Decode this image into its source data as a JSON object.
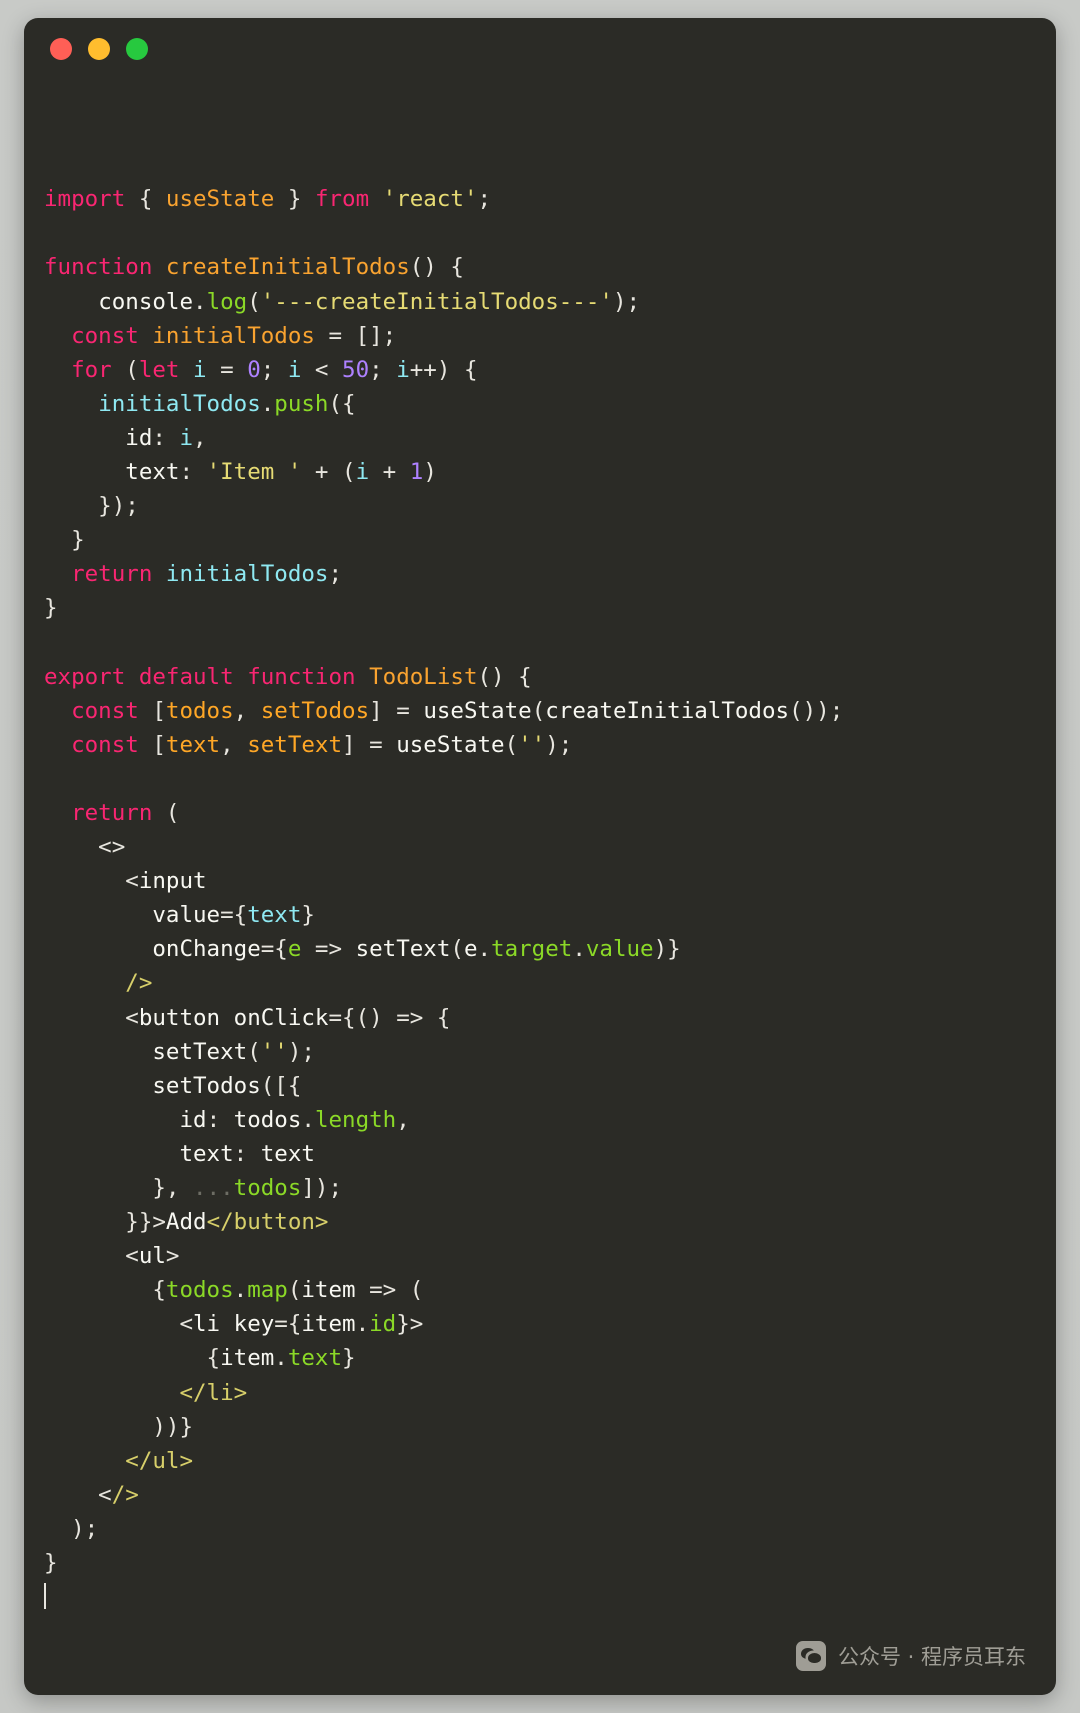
{
  "window": {
    "traffic_lights": [
      {
        "name": "close",
        "color": "#ff5f56"
      },
      {
        "name": "minimize",
        "color": "#ffbd2e"
      },
      {
        "name": "maximize",
        "color": "#27c93f"
      }
    ]
  },
  "theme": {
    "background": "#2b2b26",
    "page_background": "#c8cac7",
    "plain": "#f8f8f2",
    "keyword": "#f92672",
    "function": "#f9a330",
    "string": "#e6db74",
    "number": "#ae81ff",
    "identifier": "#8fe9f2",
    "property": "#8bd927",
    "closing_tag": "#d7cf6a",
    "dim": "#6d6d64"
  },
  "code": {
    "language": "jsx",
    "lines": [
      "import { useState } from 'react';",
      "",
      "function createInitialTodos() {",
      "    console.log('---createInitialTodos---');",
      "  const initialTodos = [];",
      "  for (let i = 0; i < 50; i++) {",
      "    initialTodos.push({",
      "      id: i,",
      "      text: 'Item ' + (i + 1)",
      "    });",
      "  }",
      "  return initialTodos;",
      "}",
      "",
      "export default function TodoList() {",
      "  const [todos, setTodos] = useState(createInitialTodos());",
      "  const [text, setText] = useState('');",
      "",
      "  return (",
      "    <>",
      "      <input",
      "        value={text}",
      "        onChange={e => setText(e.target.value)}",
      "      />",
      "      <button onClick={() => {",
      "        setText('');",
      "        setTodos([{",
      "          id: todos.length,",
      "          text: text",
      "        }, ...todos]);",
      "      }}>Add</button>",
      "      <ul>",
      "        {todos.map(item => (",
      "          <li key={item.id}>",
      "            {item.text}",
      "          </li>",
      "        ))}",
      "      </ul>",
      "    </>",
      "  );",
      "}"
    ]
  },
  "watermark": {
    "logo": "wechat-icon",
    "text": "公众号 · 程序员耳东"
  }
}
